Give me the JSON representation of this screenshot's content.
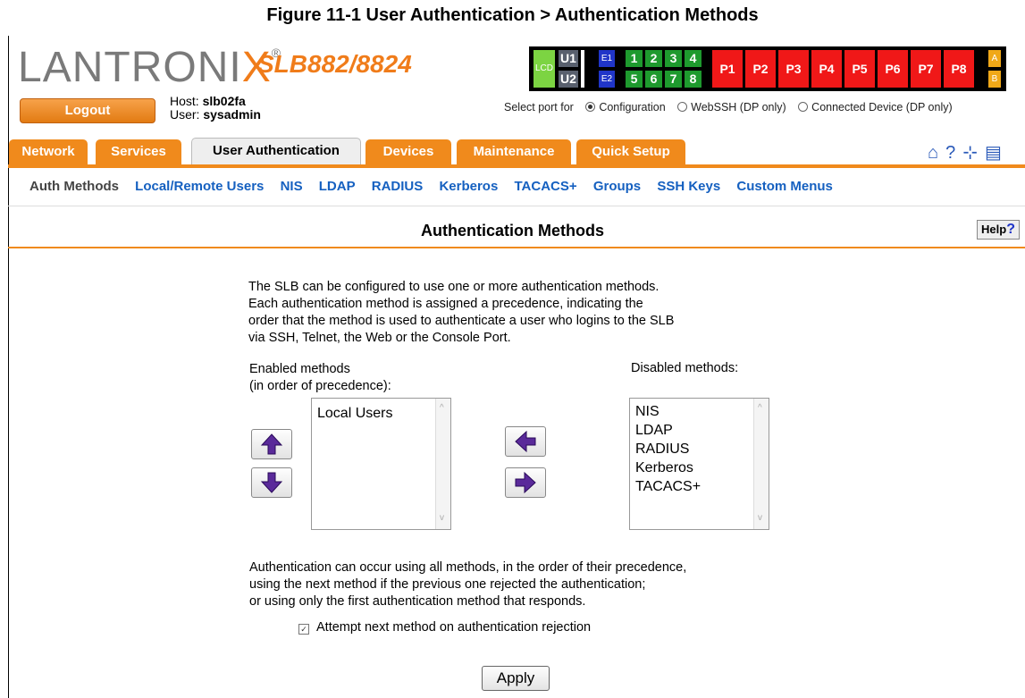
{
  "caption": "Figure 11-1  User Authentication > Authentication Methods",
  "brand": {
    "logo_main": "LANTRONI",
    "logo_x": "X",
    "logo_mark": "®",
    "model": "SLB882/8824"
  },
  "header": {
    "logout_label": "Logout",
    "host_label": "Host:",
    "host_value": "slb02fa",
    "user_label": "User:",
    "user_value": "sysadmin"
  },
  "ports": {
    "lcd": "LCD",
    "u": [
      "U1",
      "U2"
    ],
    "e": [
      "E1",
      "E2"
    ],
    "numbers_top": [
      "1",
      "2",
      "3",
      "4"
    ],
    "numbers_bottom": [
      "5",
      "6",
      "7",
      "8"
    ],
    "p": [
      "P1",
      "P2",
      "P3",
      "P4",
      "P5",
      "P6",
      "P7",
      "P8"
    ],
    "ab": [
      "A",
      "B"
    ]
  },
  "select_port": {
    "label": "Select port for",
    "options": [
      "Configuration",
      "WebSSH (DP only)",
      "Connected Device (DP only)"
    ],
    "selected": "Configuration"
  },
  "tabs": [
    "Network",
    "Services",
    "User Authentication",
    "Devices",
    "Maintenance",
    "Quick Setup"
  ],
  "active_tab": "User Authentication",
  "toolbar_icons": [
    "home-icon",
    "help-question-icon",
    "expand-icon",
    "log-icon"
  ],
  "subnav": [
    "Auth Methods",
    "Local/Remote Users",
    "NIS",
    "LDAP",
    "RADIUS",
    "Kerberos",
    "TACACS+",
    "Groups",
    "SSH Keys",
    "Custom Menus"
  ],
  "page": {
    "title": "Authentication Methods",
    "help_label": "Help",
    "help_q": "?",
    "description": [
      "The SLB can be configured to use one or more authentication methods.",
      "Each authentication method is assigned a precedence, indicating the",
      "order that the method is used to authenticate a user who logins to the SLB",
      "via SSH, Telnet, the Web or the Console Port."
    ],
    "enabled_label_1": "Enabled methods",
    "enabled_label_2": "(in order of precedence):",
    "disabled_label": "Disabled methods:",
    "enabled_methods": [
      "Local Users"
    ],
    "disabled_methods": [
      "NIS",
      "LDAP",
      "RADIUS",
      "Kerberos",
      "TACACS+"
    ],
    "footer_text": [
      "Authentication can occur using all methods, in the order of their precedence,",
      "using the next method if the previous one rejected the authentication;",
      "or using only the first authentication method that responds."
    ],
    "attempt_label": "Attempt next method on authentication rejection",
    "attempt_checked": true,
    "apply_label": "Apply"
  },
  "colors": {
    "accent": "#f08a1c",
    "link": "#1560c0",
    "arrow": "#5a2a9a"
  }
}
